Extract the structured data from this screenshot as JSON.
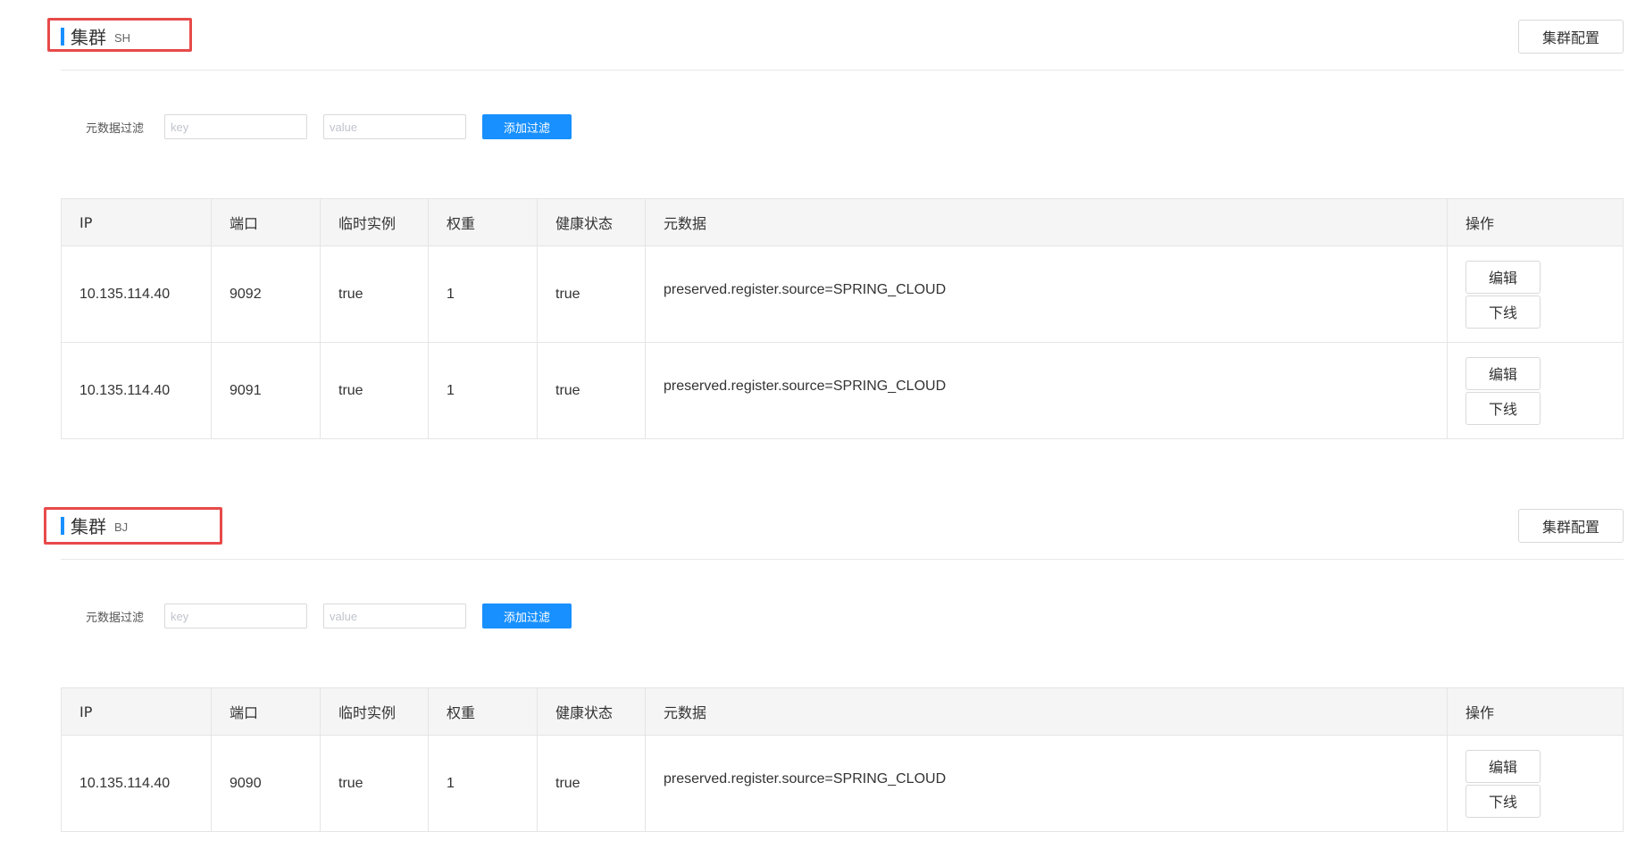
{
  "clusters": [
    {
      "title": "集群",
      "name": "SH",
      "config_label": "集群配置",
      "filter": {
        "label": "元数据过滤",
        "key_placeholder": "key",
        "value_placeholder": "value",
        "button_label": "添加过滤"
      },
      "columns": [
        "IP",
        "端口",
        "临时实例",
        "权重",
        "健康状态",
        "元数据",
        "操作"
      ],
      "rows": [
        {
          "ip": "10.135.114.40",
          "port": "9092",
          "ephemeral": "true",
          "weight": "1",
          "healthy": "true",
          "metadata": "preserved.register.source=SPRING_CLOUD"
        },
        {
          "ip": "10.135.114.40",
          "port": "9091",
          "ephemeral": "true",
          "weight": "1",
          "healthy": "true",
          "metadata": "preserved.register.source=SPRING_CLOUD"
        }
      ],
      "actions": {
        "edit": "编辑",
        "offline": "下线"
      }
    },
    {
      "title": "集群",
      "name": "BJ",
      "config_label": "集群配置",
      "filter": {
        "label": "元数据过滤",
        "key_placeholder": "key",
        "value_placeholder": "value",
        "button_label": "添加过滤"
      },
      "columns": [
        "IP",
        "端口",
        "临时实例",
        "权重",
        "健康状态",
        "元数据",
        "操作"
      ],
      "rows": [
        {
          "ip": "10.135.114.40",
          "port": "9090",
          "ephemeral": "true",
          "weight": "1",
          "healthy": "true",
          "metadata": "preserved.register.source=SPRING_CLOUD"
        }
      ],
      "actions": {
        "edit": "编辑",
        "offline": "下线"
      }
    }
  ],
  "colors": {
    "accent": "#1890ff",
    "highlight": "#e84a4a"
  }
}
